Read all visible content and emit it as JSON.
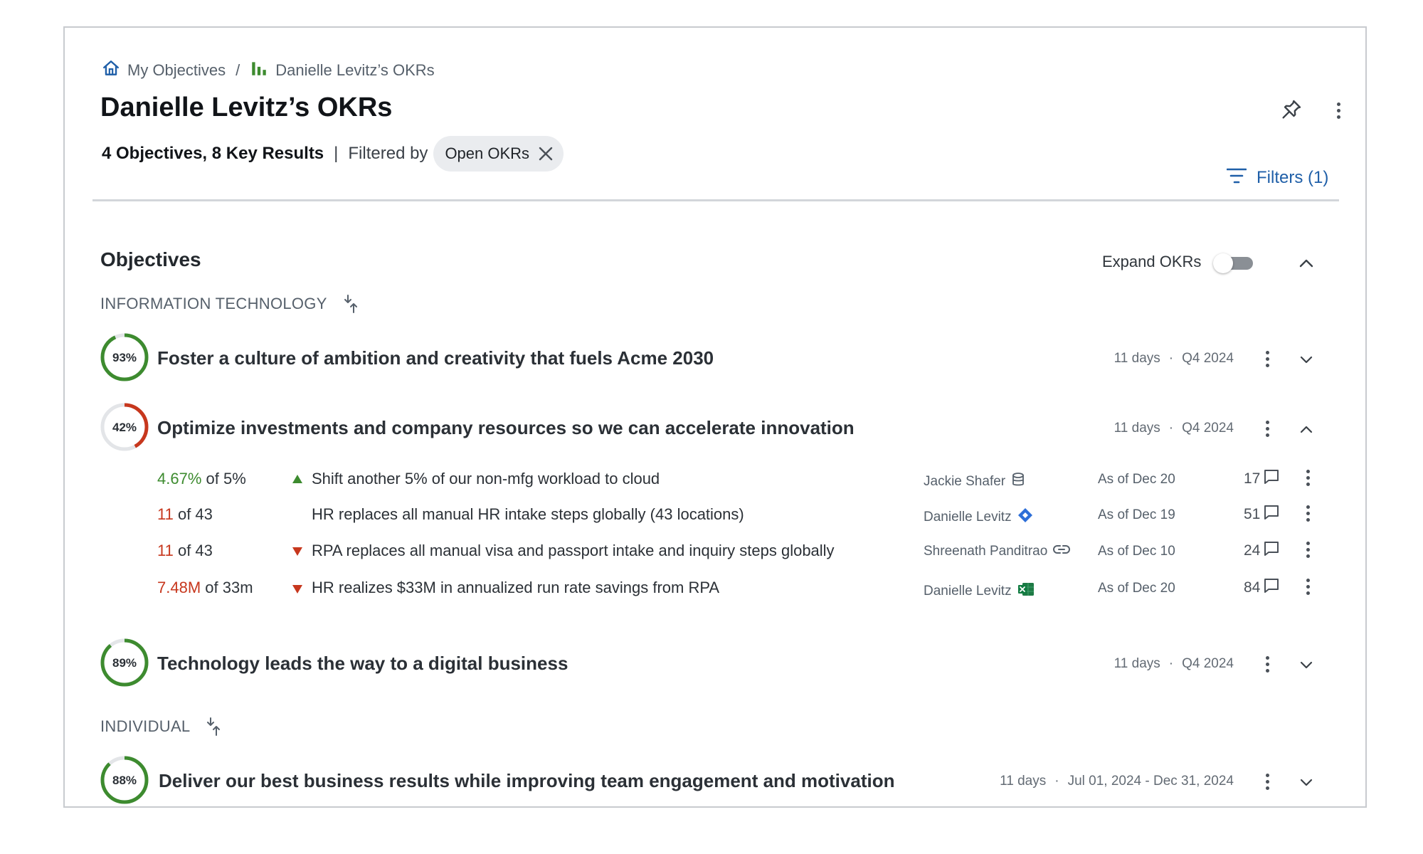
{
  "breadcrumb": {
    "home_label": "My Objectives",
    "separator": "/",
    "current_label": "Danielle Levitz’s OKRs",
    "home_icon": "home-icon",
    "current_icon": "bar-chart-icon"
  },
  "header": {
    "title": "Danielle Levitz’s OKRs",
    "summary_count": "4 Objectives, 8 Key Results",
    "pipe": "|",
    "filtered_by_label": "Filtered by",
    "filter_chip_label": "Open OKRs",
    "filters_button_label": "Filters (1)",
    "pin_icon": "pin-icon",
    "more_icon": "kebab-menu-icon"
  },
  "objectives_section": {
    "title": "Objectives",
    "expand_label": "Expand OKRs",
    "expand_enabled": false
  },
  "groups": [
    {
      "label": "INFORMATION TECHNOLOGY",
      "objectives": [
        {
          "percent_label": "93%",
          "progress": 0.93,
          "title": "Foster a culture of ambition and creativity that fuels Acme 2030",
          "days": "11 days",
          "period": "Q4 2024",
          "expanded": false
        },
        {
          "percent_label": "42%",
          "progress": 0.42,
          "title": "Optimize investments and company resources so we can accelerate innovation",
          "days": "11 days",
          "period": "Q4 2024",
          "expanded": true,
          "key_results": [
            {
              "current": "4.67%",
              "target": "of 5%",
              "status": "good",
              "trend": "up",
              "title": "Shift another 5% of our non-mfg workload to cloud",
              "owner": "Jackie Shafer",
              "source_icon": "database-icon",
              "as_of": "As of Dec 20",
              "comments": "17"
            },
            {
              "current": "11",
              "target": "of 43",
              "status": "bad",
              "trend": "none",
              "title": "HR replaces all manual HR intake steps globally (43 locations)",
              "owner": "Danielle Levitz",
              "source_icon": "jira-icon",
              "as_of": "As of Dec 19",
              "comments": "51"
            },
            {
              "current": "11",
              "target": "of 43",
              "status": "bad",
              "trend": "down",
              "title": "RPA replaces all manual visa and passport intake and inquiry steps globally",
              "owner": "Shreenath Panditrao",
              "source_icon": "link-icon",
              "as_of": "As of Dec 10",
              "comments": "24"
            },
            {
              "current": "7.48M",
              "target": "of 33m",
              "status": "bad",
              "trend": "down",
              "title": "HR realizes $33M in annualized run rate savings from RPA",
              "owner": "Danielle Levitz",
              "source_icon": "excel-icon",
              "as_of": "As of Dec 20",
              "comments": "84"
            }
          ]
        },
        {
          "percent_label": "89%",
          "progress": 0.89,
          "title": "Technology leads the way to a digital business",
          "days": "11 days",
          "period": "Q4 2024",
          "expanded": false
        }
      ]
    },
    {
      "label": "INDIVIDUAL",
      "objectives": [
        {
          "percent_label": "88%",
          "progress": 0.88,
          "title": "Deliver our best business results while improving team engagement and motivation",
          "days": "11 days",
          "period": "Jul 01, 2024 - Dec 31, 2024",
          "expanded": false
        }
      ]
    }
  ],
  "meta_separator": "·",
  "colors": {
    "progress_good": "#3d8b2f",
    "progress_bad": "#c7371d",
    "progress_track": "#e3e5e8",
    "accent_blue": "#1f5fa8"
  }
}
